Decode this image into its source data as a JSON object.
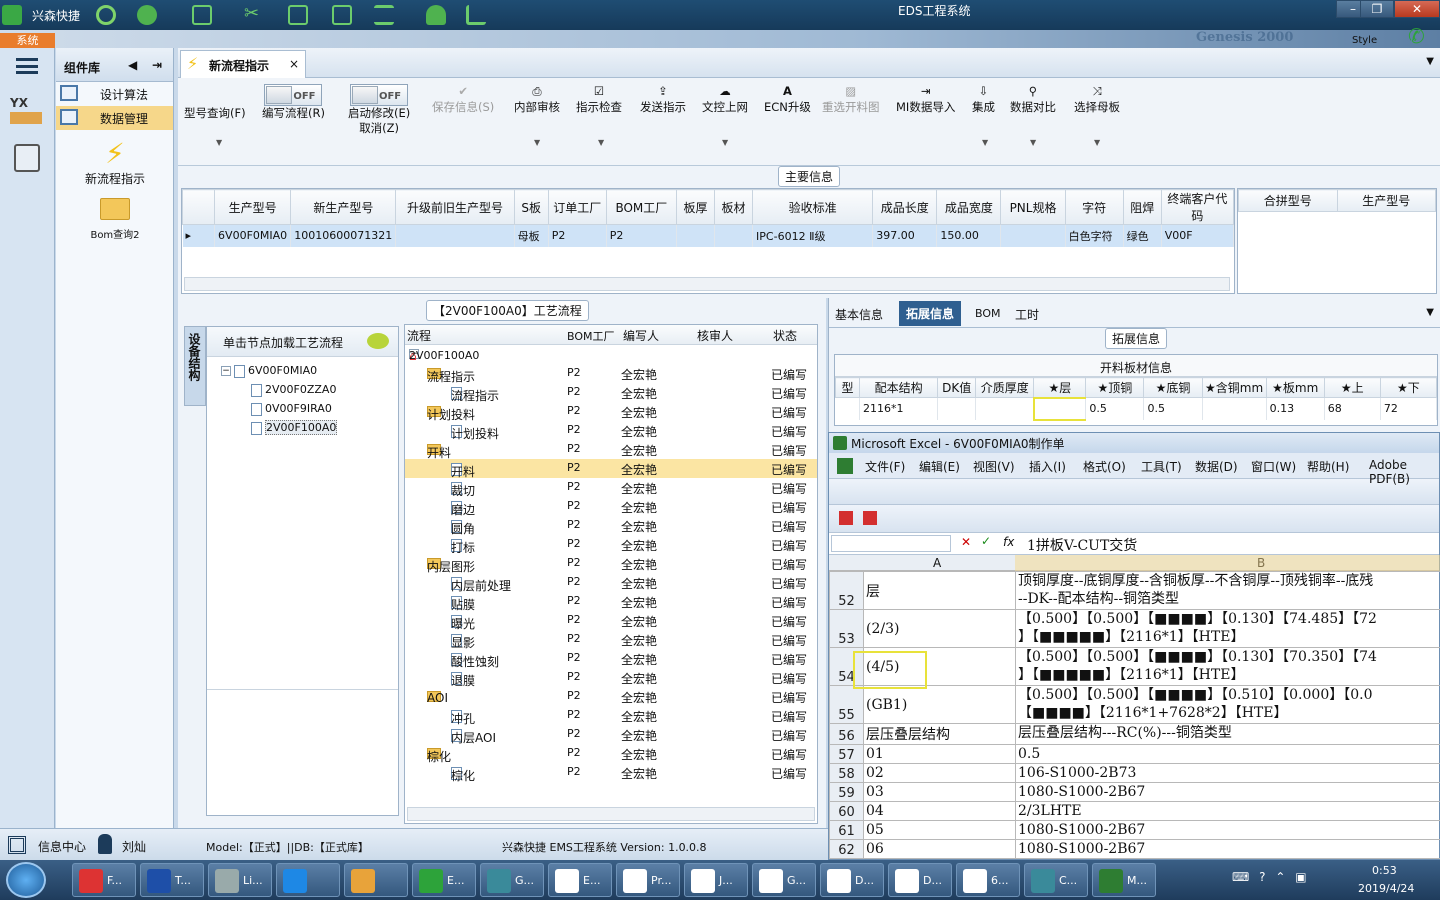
{
  "app": {
    "title": "EDS工程系统",
    "brand": "兴森快捷",
    "style_label": "Style",
    "system_tab": "系统",
    "banner_text": "Genesis 2000"
  },
  "sidebar": {
    "header": "组件库",
    "items": [
      {
        "label": "设计算法"
      },
      {
        "label": "数据管理"
      }
    ],
    "big_items": [
      {
        "label": "新流程指示"
      },
      {
        "label": "Bom查询2"
      }
    ]
  },
  "doc_tab": {
    "label": "新流程指示"
  },
  "toolbar": {
    "buttons": [
      {
        "label": "型号查询(F)"
      },
      {
        "label": "编写流程(R)",
        "toggle": "OFF"
      },
      {
        "label": "启动修改(E)",
        "sub": "取消(Z)",
        "toggle": "OFF"
      },
      {
        "label": "保存信息(S)"
      },
      {
        "label": "内部审核"
      },
      {
        "label": "指示检查"
      },
      {
        "label": "发送指示"
      },
      {
        "label": "文控上网"
      },
      {
        "label": "ECN升级"
      },
      {
        "label": "重选开料图"
      },
      {
        "label": "MI数据导入"
      },
      {
        "label": "集成"
      },
      {
        "label": "数据对比"
      },
      {
        "label": "选择母板"
      }
    ]
  },
  "main_info": {
    "title": "主要信息",
    "columns": [
      "生产型号",
      "新生产型号",
      "升级前旧生产型号",
      "S板",
      "订单工厂",
      "BOM工厂",
      "板厚",
      "板材",
      "验收标准",
      "成品长度",
      "成品宽度",
      "PNL规格",
      "字符",
      "阻焊",
      "终端客户代码"
    ],
    "row": [
      "6V00F0MIA0",
      "10010600071321",
      "",
      "母板",
      "P2",
      "P2",
      "",
      "",
      "IPC-6012 Ⅱ级",
      "397.00",
      "150.00",
      "",
      "白色字符",
      "绿色",
      "V00F"
    ],
    "side_columns": [
      "合拼型号",
      "生产型号"
    ]
  },
  "process": {
    "title": "【2V00F100A0】工艺流程",
    "side_tab": "设备结构",
    "click_hint": "单击节点加载工艺流程",
    "tree": [
      "6V00F0MIA0",
      "2V00F0ZZA0",
      "0V00F9IRA0",
      "2V00F100A0"
    ],
    "columns": [
      "流程",
      "BOM工厂",
      "编写人",
      "核审人",
      "状态"
    ],
    "root": "2V00F100A0",
    "rows": [
      {
        "name": "流程指示",
        "level": 1,
        "folder": true,
        "bom": "P2",
        "author": "全宏艳",
        "status": "已编写"
      },
      {
        "name": "流程指示",
        "level": 2,
        "folder": false,
        "bom": "P2",
        "author": "全宏艳",
        "status": "已编写"
      },
      {
        "name": "计划投料",
        "level": 1,
        "folder": true,
        "bom": "P2",
        "author": "全宏艳",
        "status": "已编写"
      },
      {
        "name": "计划投料",
        "level": 2,
        "folder": false,
        "bom": "P2",
        "author": "全宏艳",
        "status": "已编写"
      },
      {
        "name": "开料",
        "level": 1,
        "folder": true,
        "bom": "P2",
        "author": "全宏艳",
        "status": "已编写"
      },
      {
        "name": "开料",
        "level": 2,
        "folder": false,
        "bom": "P2",
        "author": "全宏艳",
        "status": "已编写",
        "selected": true
      },
      {
        "name": "裁切",
        "level": 2,
        "folder": false,
        "bom": "P2",
        "author": "全宏艳",
        "status": "已编写"
      },
      {
        "name": "磨边",
        "level": 2,
        "folder": false,
        "bom": "P2",
        "author": "全宏艳",
        "status": "已编写"
      },
      {
        "name": "圆角",
        "level": 2,
        "folder": false,
        "bom": "P2",
        "author": "全宏艳",
        "status": "已编写"
      },
      {
        "name": "打标",
        "level": 2,
        "folder": false,
        "bom": "P2",
        "author": "全宏艳",
        "status": "已编写"
      },
      {
        "name": "内层图形",
        "level": 1,
        "folder": true,
        "bom": "P2",
        "author": "全宏艳",
        "status": "已编写"
      },
      {
        "name": "内层前处理",
        "level": 2,
        "folder": false,
        "bom": "P2",
        "author": "全宏艳",
        "status": "已编写"
      },
      {
        "name": "贴膜",
        "level": 2,
        "folder": false,
        "bom": "P2",
        "author": "全宏艳",
        "status": "已编写"
      },
      {
        "name": "曝光",
        "level": 2,
        "folder": false,
        "bom": "P2",
        "author": "全宏艳",
        "status": "已编写"
      },
      {
        "name": "显影",
        "level": 2,
        "folder": false,
        "bom": "P2",
        "author": "全宏艳",
        "status": "已编写"
      },
      {
        "name": "酸性蚀刻",
        "level": 2,
        "folder": false,
        "bom": "P2",
        "author": "全宏艳",
        "status": "已编写"
      },
      {
        "name": "退膜",
        "level": 2,
        "folder": false,
        "bom": "P2",
        "author": "全宏艳",
        "status": "已编写"
      },
      {
        "name": "AOI",
        "level": 1,
        "folder": true,
        "bom": "P2",
        "author": "全宏艳",
        "status": "已编写"
      },
      {
        "name": "冲孔",
        "level": 2,
        "folder": false,
        "bom": "P2",
        "author": "全宏艳",
        "status": "已编写"
      },
      {
        "name": "内层AOI",
        "level": 2,
        "folder": false,
        "bom": "P2",
        "author": "全宏艳",
        "status": "已编写"
      },
      {
        "name": "棕化",
        "level": 1,
        "folder": true,
        "bom": "P2",
        "author": "全宏艳",
        "status": "已编写"
      },
      {
        "name": "棕化",
        "level": 2,
        "folder": false,
        "bom": "P2",
        "author": "全宏艳",
        "status": "已编写"
      }
    ]
  },
  "right_tabs": [
    "基本信息",
    "拓展信息",
    "BOM",
    "工时"
  ],
  "ext_info": {
    "title": "拓展信息",
    "table_title": "开料板材信息",
    "columns": [
      "型",
      "配本结构",
      "DK值",
      "介质厚度",
      "★层",
      "★顶铜",
      "★底铜",
      "★含铜mm",
      "★板mm",
      "★上",
      "★下"
    ],
    "row": [
      "",
      "2116*1",
      "",
      "",
      "",
      "0.5",
      "0.5",
      "",
      "0.13",
      "68",
      "72"
    ]
  },
  "excel": {
    "title": "Microsoft Excel - 6V00F0MIA0制作单",
    "menus": [
      "文件(F)",
      "编辑(E)",
      "视图(V)",
      "插入(I)",
      "格式(O)",
      "工具(T)",
      "数据(D)",
      "窗口(W)",
      "帮助(H)",
      "Adobe PDF(B)"
    ],
    "formula": "1拼板V-CUT交货",
    "col_a": "A",
    "col_b": "B",
    "rows": [
      {
        "n": "52",
        "a": "层",
        "b": [
          "顶铜厚度--底铜厚度--含铜板厚--不含铜厚--顶残铜率--底残",
          "--DK--配本结构--铜箔类型"
        ]
      },
      {
        "n": "53",
        "a": "(2/3)",
        "b": [
          "【0.500】【0.500】【■■■■】【0.130】【74.485】【72",
          "】【■■■■■】【2116*1】【HTE】"
        ]
      },
      {
        "n": "54",
        "a": "(4/5)",
        "b": [
          "【0.500】【0.500】【■■■■】【0.130】【70.350】【74",
          "】【■■■■■】【2116*1】【HTE】"
        ]
      },
      {
        "n": "55",
        "a": "(GB1)",
        "b": [
          "【0.500】【0.500】【■■■■】【0.510】【0.000】【0.0",
          "【■■■■】【2116*1+7628*2】【HTE】"
        ]
      },
      {
        "n": "56",
        "a": "层压叠层结构",
        "b": [
          "层压叠层结构---RC(%)---铜箔类型"
        ]
      },
      {
        "n": "57",
        "a": "01",
        "b": [
          "0.5"
        ]
      },
      {
        "n": "58",
        "a": "02",
        "b": [
          "106-S1000-2B73"
        ]
      },
      {
        "n": "59",
        "a": "03",
        "b": [
          "1080-S1000-2B67"
        ]
      },
      {
        "n": "60",
        "a": "04",
        "b": [
          "2/3LHTE"
        ]
      },
      {
        "n": "61",
        "a": "05",
        "b": [
          "1080-S1000-2B67"
        ]
      },
      {
        "n": "62",
        "a": "06",
        "b": [
          "1080-S1000-2B67"
        ]
      }
    ]
  },
  "status": {
    "info_center": "信息中心",
    "user": "刘灿",
    "model": "Model:【正式】||DB:【正式库】",
    "version": "兴森快捷  EMS工程系统  Version: 1.0.0.8"
  },
  "taskbar": {
    "items": [
      "F...",
      "T...",
      "Li...",
      "",
      "",
      "E...",
      "G...",
      "E...",
      "Pr...",
      "J...",
      "G...",
      "D...",
      "D...",
      "6...",
      "C...",
      "M..."
    ],
    "time": "0:53",
    "date": "2019/4/24"
  }
}
